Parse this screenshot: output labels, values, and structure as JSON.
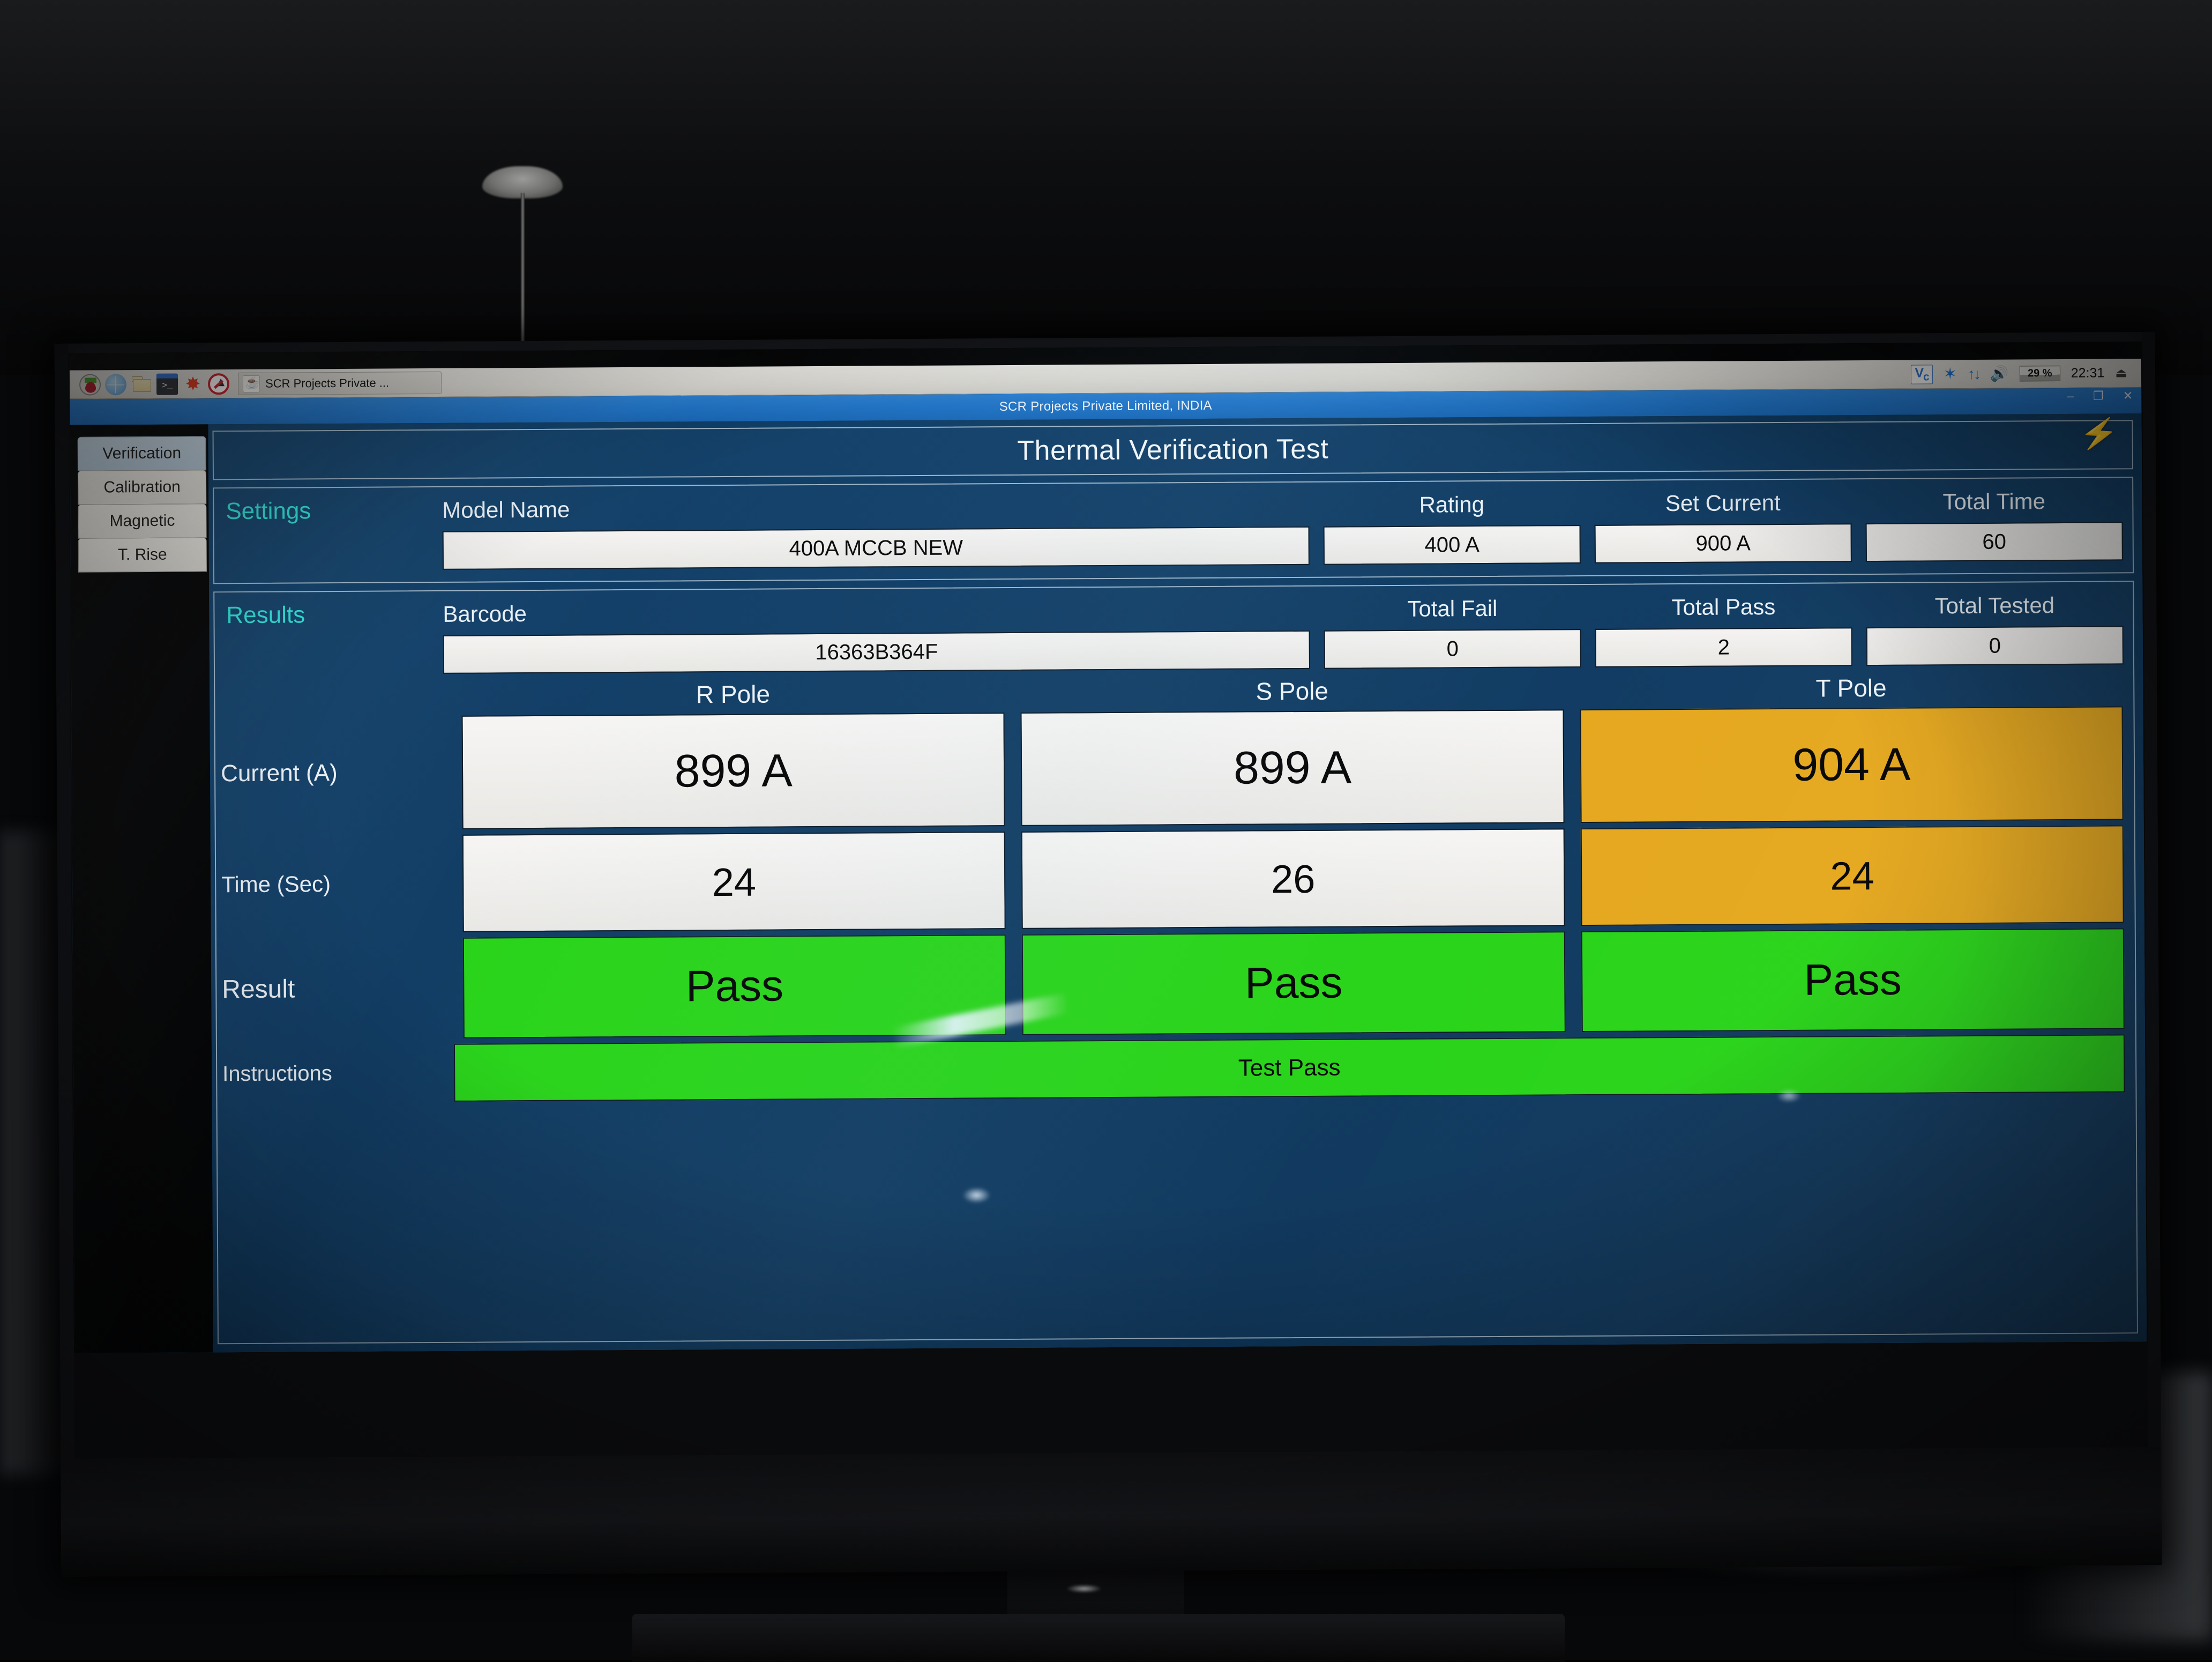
{
  "taskbar": {
    "launchers": [
      {
        "name": "raspberry-pi-menu-icon",
        "label": "Raspberry Pi Menu"
      },
      {
        "name": "web-browser-icon",
        "label": "Web Browser"
      },
      {
        "name": "file-manager-icon",
        "label": "File Manager"
      },
      {
        "name": "terminal-icon",
        "label": "Terminal",
        "glyph": ">_"
      },
      {
        "name": "mathematica-icon",
        "label": "Mathematica"
      },
      {
        "name": "wolfram-icon",
        "label": "Wolfram"
      }
    ],
    "task_window_label": "SCR Projects Private ...",
    "tray": {
      "vnc": "V",
      "bluetooth": "✶",
      "network": "↑↓",
      "volume": "🔊",
      "cpu": "29 %",
      "clock": "22:31",
      "eject": "⏏"
    }
  },
  "window": {
    "title": "SCR Projects Private Limited, INDIA",
    "minimize": "–",
    "maximize": "❐",
    "close": "✕",
    "undervolt_icon": "⚡"
  },
  "sidebar": {
    "tabs": [
      {
        "label": "Verification",
        "selected": true
      },
      {
        "label": "Calibration",
        "selected": false
      },
      {
        "label": "Magnetic",
        "selected": false
      },
      {
        "label": "T. Rise",
        "selected": false
      }
    ]
  },
  "page": {
    "title": "Thermal Verification Test"
  },
  "settings": {
    "section_label": "Settings",
    "headers": {
      "model_name": "Model Name",
      "rating": "Rating",
      "set_current": "Set Current",
      "total_time": "Total Time"
    },
    "values": {
      "model_name": "400A MCCB  NEW",
      "rating": "400 A",
      "set_current": "900 A",
      "total_time": "60"
    }
  },
  "results": {
    "section_label": "Results",
    "headers": {
      "barcode": "Barcode",
      "total_fail": "Total Fail",
      "total_pass": "Total Pass",
      "total_tested": "Total Tested"
    },
    "values": {
      "barcode": "16363B364F",
      "total_fail": "0",
      "total_pass": "2",
      "total_tested": "0"
    }
  },
  "matrix": {
    "poles": [
      "R Pole",
      "S Pole",
      "T Pole"
    ],
    "row_labels": {
      "current": "Current (A)",
      "time": "Time (Sec)",
      "result": "Result",
      "instructions": "Instructions"
    },
    "current": [
      {
        "value": "899 A",
        "state": "normal"
      },
      {
        "value": "899 A",
        "state": "normal"
      },
      {
        "value": "904 A",
        "state": "warn"
      }
    ],
    "time": [
      {
        "value": "24",
        "state": "normal"
      },
      {
        "value": "26",
        "state": "normal"
      },
      {
        "value": "24",
        "state": "warn"
      }
    ],
    "result": [
      {
        "value": "Pass",
        "state": "pass"
      },
      {
        "value": "Pass",
        "state": "pass"
      },
      {
        "value": "Pass",
        "state": "pass"
      }
    ],
    "instructions": {
      "value": "Test Pass",
      "state": "pass"
    }
  },
  "colors": {
    "panel_blue": "#0f3c63",
    "title_blue": "#1f72c4",
    "accent_cyan": "#2fe2d8",
    "pass_green": "#2ad41a",
    "warn_amber": "#e5a81f",
    "field_white": "#f1f0ee"
  }
}
